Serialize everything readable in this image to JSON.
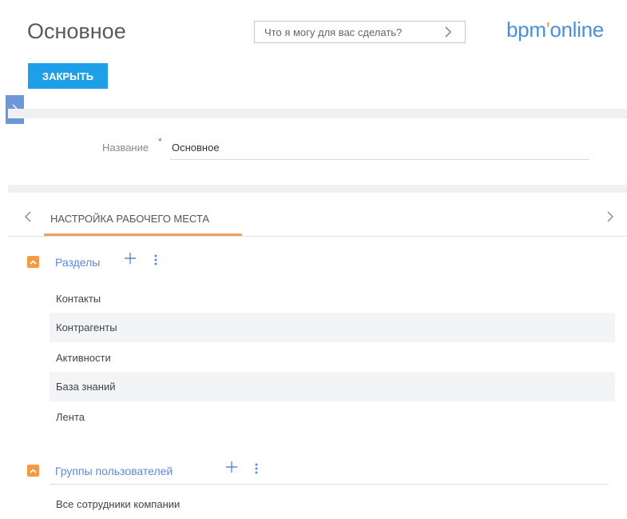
{
  "header": {
    "title": "Основное",
    "search_placeholder": "Что я могу для вас сделать?",
    "logo_part1": "bpm",
    "logo_dot": "'",
    "logo_part2": "online",
    "close_label": "ЗАКРЫТЬ"
  },
  "form": {
    "name_label": "Название",
    "required_mark": "*",
    "name_value": "Основное"
  },
  "tabs": {
    "active_label": "НАСТРОЙКА РАБОЧЕГО МЕСТА"
  },
  "sections_group": {
    "title": "Разделы",
    "items": [
      "Контакты",
      "Контрагенты",
      "Активности",
      "База знаний",
      "Лента"
    ]
  },
  "user_groups": {
    "title": "Группы пользователей",
    "items": [
      "Все сотрудники компании"
    ]
  },
  "colors": {
    "accent_blue": "#1ea0e8",
    "tab_orange": "#f0a25f",
    "link_blue": "#5b8ad6"
  }
}
